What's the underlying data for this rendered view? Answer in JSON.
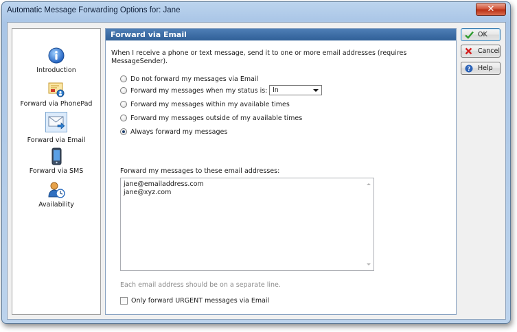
{
  "window": {
    "title": "Automatic Message Forwarding Options for: Jane",
    "close_label": "✕"
  },
  "nav": {
    "items": [
      {
        "label": "Introduction",
        "icon": "info-icon"
      },
      {
        "label": "Forward via PhonePad",
        "icon": "phonepad-icon"
      },
      {
        "label": "Forward via Email",
        "icon": "email-icon",
        "selected": true
      },
      {
        "label": "Forward via SMS",
        "icon": "phone-icon"
      },
      {
        "label": "Availability",
        "icon": "availability-icon"
      }
    ]
  },
  "content": {
    "header": "Forward via Email",
    "intro": "When I receive a phone or text message, send it to one or more email addresses (requires MessageSender).",
    "options": [
      {
        "label": "Do not forward my messages via Email",
        "checked": false
      },
      {
        "label": "Forward my messages when my status is:",
        "checked": false
      },
      {
        "label": "Forward my messages within my available times",
        "checked": false
      },
      {
        "label": "Forward my messages outside of my available times",
        "checked": false
      },
      {
        "label": "Always forward my messages",
        "checked": true
      }
    ],
    "status_select": {
      "value": "In"
    },
    "addresses_label": "Forward my messages to these email addresses:",
    "addresses": [
      "jane@emailaddress.com",
      "jane@xyz.com"
    ],
    "hint": "Each email address should be on a separate line.",
    "urgent_checkbox": {
      "label": "Only forward URGENT messages via Email",
      "checked": false
    }
  },
  "buttons": {
    "ok": "OK",
    "cancel": "Cancel",
    "help": "Help"
  },
  "colors": {
    "header_bg": "#3a6aa3",
    "close_btn": "#c8452a",
    "ok_check": "#2e9b2e",
    "cancel_x": "#d42020"
  }
}
